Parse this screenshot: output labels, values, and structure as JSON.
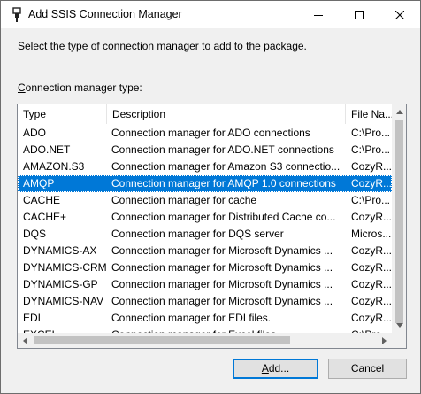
{
  "window": {
    "title": "Add SSIS Connection Manager",
    "controls": {
      "minimize": "minimize-icon",
      "maximize": "maximize-icon",
      "close": "close-icon"
    }
  },
  "intro_text": "Select the type of connection manager to add to the package.",
  "list_label": {
    "mnemonic": "C",
    "rest": "onnection manager type:"
  },
  "table": {
    "columns": [
      "Type",
      "Description",
      "File Na..."
    ],
    "rows": [
      {
        "type": "ADO",
        "description": "Connection manager for ADO connections",
        "file": "C:\\Pro..."
      },
      {
        "type": "ADO.NET",
        "description": "Connection manager for ADO.NET connections",
        "file": "C:\\Pro..."
      },
      {
        "type": "AMAZON.S3",
        "description": "Connection manager for Amazon S3 connectio...",
        "file": "CozyR..."
      },
      {
        "type": "AMQP",
        "description": "Connection manager for AMQP 1.0 connections",
        "file": "CozyR...",
        "selected": true
      },
      {
        "type": "CACHE",
        "description": "Connection manager for cache",
        "file": "C:\\Pro..."
      },
      {
        "type": "CACHE+",
        "description": "Connection manager for Distributed Cache co...",
        "file": "CozyR..."
      },
      {
        "type": "DQS",
        "description": "Connection manager for DQS server",
        "file": "Micros..."
      },
      {
        "type": "DYNAMICS-AX",
        "description": "Connection manager for Microsoft Dynamics ...",
        "file": "CozyR..."
      },
      {
        "type": "DYNAMICS-CRM",
        "description": "Connection manager for Microsoft Dynamics ...",
        "file": "CozyR..."
      },
      {
        "type": "DYNAMICS-GP",
        "description": "Connection manager for Microsoft Dynamics ...",
        "file": "CozyR..."
      },
      {
        "type": "DYNAMICS-NAV",
        "description": "Connection manager for Microsoft Dynamics ...",
        "file": "CozyR..."
      },
      {
        "type": "EDI",
        "description": "Connection manager for EDI files.",
        "file": "CozyR..."
      },
      {
        "type": "EXCEL",
        "description": "Connection manager for Excel files",
        "file": "C:\\Pro..."
      }
    ]
  },
  "buttons": {
    "add": "Add...",
    "cancel": "Cancel"
  },
  "colors": {
    "selection": "#0078d7",
    "accent_border": "#0078d7"
  }
}
